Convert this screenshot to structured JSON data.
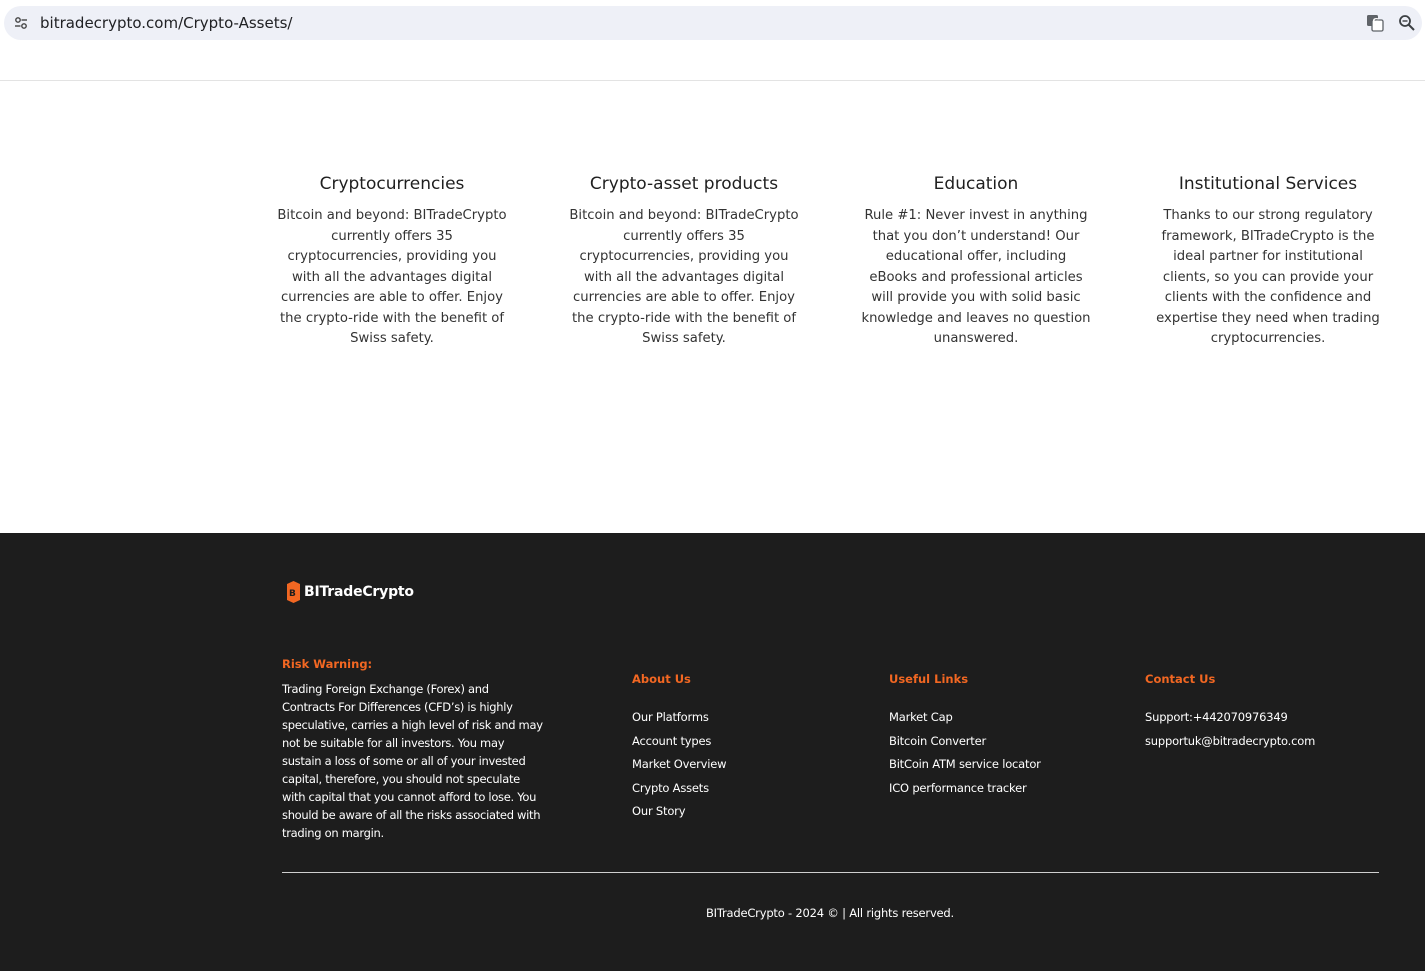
{
  "browser": {
    "url": "bitradecrypto.com/Crypto-Assets/",
    "site_icon": "tune-icon",
    "translate_icon": "translate-icon",
    "zoom_icon": "zoom-icon"
  },
  "features": [
    {
      "title": "Cryptocurrencies",
      "text": "Bitcoin and beyond: BITradeCrypto currently offers 35 cryptocurrencies, providing you with all the advantages digital currencies are able to offer. Enjoy the crypto-ride with the benefit of Swiss safety."
    },
    {
      "title": "Crypto-asset products",
      "text": "Bitcoin and beyond: BITradeCrypto currently offers 35 cryptocurrencies, providing you with all the advantages digital currencies are able to offer. Enjoy the crypto-ride with the benefit of Swiss safety."
    },
    {
      "title": "Education",
      "text": "Rule #1: Never invest in anything that you don’t understand! Our educational offer, including eBooks and professional articles will provide you with solid basic knowledge and leaves no question unanswered."
    },
    {
      "title": "Institutional Services",
      "text": "Thanks to our strong regulatory framework, BITradeCrypto is the ideal partner for institutional clients, so you can provide your clients with the confidence and expertise they need when trading cryptocurrencies."
    }
  ],
  "footer": {
    "logo_text": "BITradeCrypto",
    "accent_color": "#f26722",
    "risk": {
      "title": "Risk Warning:",
      "text": "Trading Foreign Exchange (Forex) and Contracts For Differences (CFD’s) is highly speculative, carries a high level of risk and may not be suitable for all investors. You may sustain a loss of some or all of your invested capital, therefore, you should not speculate with capital that you cannot afford to lose. You should be aware of all the risks associated with trading on margin."
    },
    "about": {
      "title": "About Us",
      "items": [
        "Our Platforms",
        "Account types",
        "Market Overview",
        "Crypto Assets",
        "Our Story"
      ]
    },
    "links": {
      "title": "Useful Links",
      "items": [
        "Market Cap",
        "Bitcoin Converter",
        "BitCoin ATM service locator",
        "ICO performance tracker"
      ]
    },
    "contact": {
      "title": "Contact Us",
      "items": [
        "Support:+442070976349",
        "supportuk@bitradecrypto.com"
      ]
    },
    "copyright": "BITradeCrypto - 2024 © | All rights reserved."
  }
}
